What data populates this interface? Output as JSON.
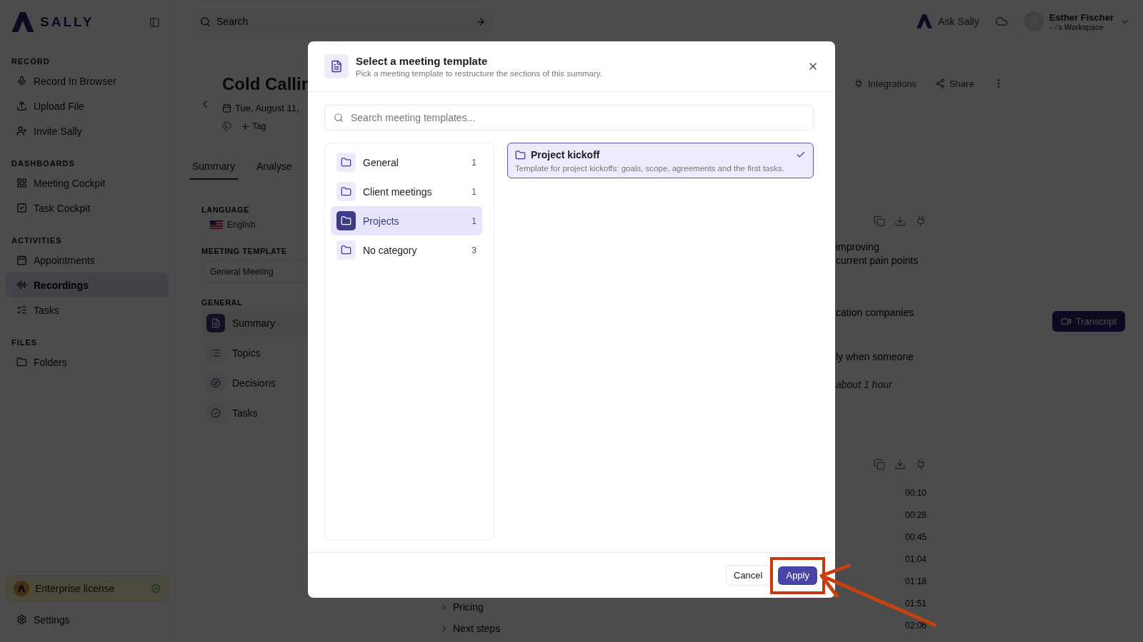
{
  "sidebar": {
    "logo": "SALLY",
    "sections": [
      {
        "heading": "RECORD",
        "items": [
          {
            "label": "Record In Browser",
            "selected": false
          },
          {
            "label": "Upload File",
            "selected": false
          },
          {
            "label": "Invite Sally",
            "selected": false
          }
        ]
      },
      {
        "heading": "DASHBOARDS",
        "items": [
          {
            "label": "Meeting Cockpit",
            "selected": false
          },
          {
            "label": "Task Cockpit",
            "selected": false
          }
        ]
      },
      {
        "heading": "ACTIVITIES",
        "items": [
          {
            "label": "Appointments",
            "selected": false
          },
          {
            "label": "Recordings",
            "selected": true
          },
          {
            "label": "Tasks",
            "selected": false
          }
        ]
      },
      {
        "heading": "FILES",
        "items": [
          {
            "label": "Folders",
            "selected": false
          }
        ]
      }
    ],
    "license": "Enterprise license",
    "settings": "Settings"
  },
  "topbar": {
    "search": {
      "placeholder": "Search"
    },
    "ask": "Ask Sally",
    "user": {
      "name": "Esther Fischer",
      "workspace": "- -'s Workspace"
    }
  },
  "meeting": {
    "title": "Cold Callin",
    "date": "Tue, August 11,",
    "tag": "Tag",
    "tabs": [
      {
        "label": "Summary",
        "selected": true
      },
      {
        "label": "Analyse",
        "selected": false
      }
    ],
    "language_label": "LANGUAGE",
    "language": "English",
    "template_label": "MEETING TEMPLATE",
    "template": "General Meeting",
    "sections_label": "GENERAL",
    "sections": [
      {
        "label": "Summary",
        "selected": true
      },
      {
        "label": "Topics",
        "selected": false
      },
      {
        "label": "Decisions",
        "selected": false
      },
      {
        "label": "Tasks",
        "selected": false
      }
    ]
  },
  "header_actions": [
    "Integrations",
    "Share"
  ],
  "summary_fragments": [
    {
      "lines": [
        "improving",
        "current pain points"
      ],
      "muted": false
    },
    {
      "lines": [
        "cation companies"
      ],
      "muted": false
    },
    {
      "lines": [
        "ly when someone"
      ],
      "muted": false
    },
    {
      "lines": [
        "about 1 hour"
      ],
      "muted": true
    }
  ],
  "outline": [
    "Pricing",
    "Next steps"
  ],
  "timestamps": [
    "00:10",
    "00:28",
    "00:45",
    "01:04",
    "01:18",
    "01:51",
    "02:06"
  ],
  "transcript_button": "Transcript",
  "dialog": {
    "title": "Select a meeting template",
    "subtitle": "Pick a meeting template to restructure the sections of this summary.",
    "search": {
      "placeholder": "Search meeting templates..."
    },
    "categories": [
      {
        "name": "General",
        "count": "1",
        "selected": false
      },
      {
        "name": "Client meetings",
        "count": "1",
        "selected": false
      },
      {
        "name": "Projects",
        "count": "1",
        "selected": true
      },
      {
        "name": "No category",
        "count": "3",
        "selected": false
      }
    ],
    "templates": [
      {
        "name": "Project kickoff",
        "description": "Template for project kickoffs: goals, scope, agreements and the first tasks.",
        "selected": true
      }
    ],
    "cancel": "Cancel",
    "apply": "Apply"
  }
}
